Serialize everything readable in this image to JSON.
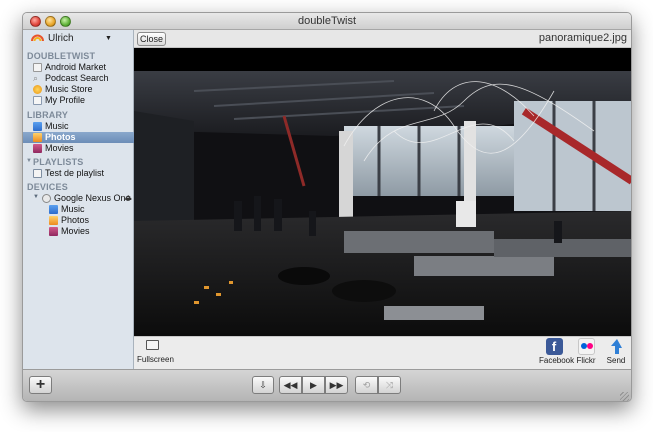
{
  "window": {
    "title": "doubleTwist"
  },
  "sidebar": {
    "user_name": "Ulrich",
    "sections": {
      "doubletwist": {
        "heading": "DOUBLETWIST",
        "items": [
          {
            "label": "Android Market",
            "icon": "android-market-icon"
          },
          {
            "label": "Podcast Search",
            "icon": "podcast-search-icon"
          },
          {
            "label": "Music Store",
            "icon": "music-store-icon"
          },
          {
            "label": "My Profile",
            "icon": "profile-icon"
          }
        ]
      },
      "library": {
        "heading": "LIBRARY",
        "items": [
          {
            "label": "Music",
            "icon": "music-icon"
          },
          {
            "label": "Photos",
            "icon": "photos-icon",
            "selected": true
          },
          {
            "label": "Movies",
            "icon": "movies-icon"
          }
        ]
      },
      "playlists": {
        "heading": "PLAYLISTS",
        "items": [
          {
            "label": "Test de playlist",
            "icon": "playlist-icon"
          }
        ]
      },
      "devices": {
        "heading": "DEVICES",
        "device_name": "Google Nexus One",
        "items": [
          {
            "label": "Music",
            "icon": "music-icon"
          },
          {
            "label": "Photos",
            "icon": "photos-icon"
          },
          {
            "label": "Movies",
            "icon": "movies-icon"
          }
        ]
      }
    }
  },
  "viewer": {
    "close_label": "Close",
    "filename": "panoramique2.jpg"
  },
  "actionbar": {
    "fullscreen_label": "Fullscreen",
    "share": [
      {
        "label": "Facebook",
        "icon": "facebook-icon",
        "color": "#3b5998"
      },
      {
        "label": "Flickr",
        "icon": "flickr-icon"
      },
      {
        "label": "Send",
        "icon": "send-icon"
      }
    ]
  },
  "colors": {
    "selection": "#6c8db7",
    "sidebar_bg": "#dde4ec",
    "section_heading": "#7d8a99"
  }
}
